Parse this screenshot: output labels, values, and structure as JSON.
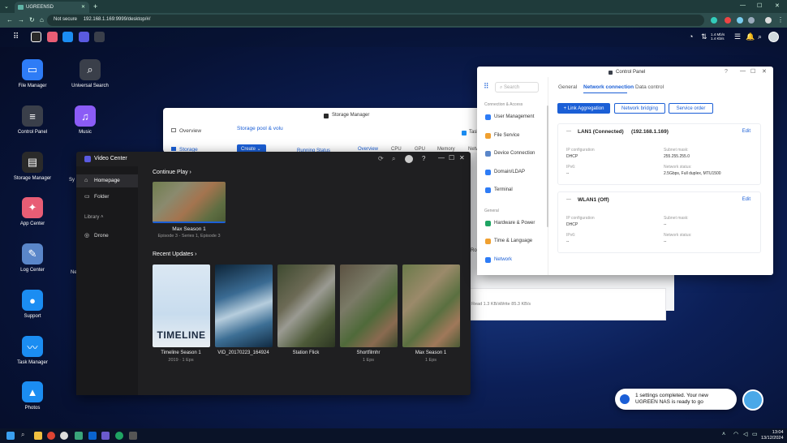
{
  "browser": {
    "tab_title": "UGREENSD",
    "not_secure": "Not secure",
    "url": "192.168.1.169:9999/desktop/#/"
  },
  "nas_bar": {
    "net_up": "1.4 Mb/s",
    "net_down": "1.4 Kb/s"
  },
  "desktop_icons": [
    {
      "label": "File Manager",
      "icon": "folder-icon",
      "color": "#2e7cf6"
    },
    {
      "label": "Universal Search",
      "icon": "search-icon",
      "color": "#3a3f4a"
    },
    {
      "label": "Control Panel",
      "icon": "control-panel-icon",
      "color": "#3a3f4a"
    },
    {
      "label": "Music",
      "icon": "music-icon",
      "color": "#8b5cf6"
    },
    {
      "label": "Storage Manager",
      "icon": "storage-icon",
      "color": "#2a2a2a"
    },
    {
      "label": "App Center",
      "icon": "app-center-icon",
      "color": "#e85d75"
    },
    {
      "label": "Log Center",
      "icon": "log-icon",
      "color": "#5a86c9"
    },
    {
      "label": "Support",
      "icon": "support-icon",
      "color": "#1b8df2"
    },
    {
      "label": "Task Manager",
      "icon": "task-manager-icon",
      "color": "#1b8df2"
    },
    {
      "label": "Photos",
      "icon": "photos-icon",
      "color": "#1b8df2"
    }
  ],
  "partial_desktop_labels": [
    "Sy",
    "Ne"
  ],
  "storage_manager": {
    "title": "Storage Manager",
    "side": [
      "Overview",
      "Storage"
    ],
    "tab": "Storage pool & volu",
    "create": "Create",
    "running": "Running Status",
    "subtabs": [
      "Overview",
      "CPU",
      "GPU",
      "Memory",
      "Netw"
    ],
    "task_label": "Task",
    "read": "Read 1.3 KB/s",
    "write": "Write 85.3 KB/s",
    "partial": "Ro"
  },
  "video_center": {
    "title": "Video Center",
    "nav": [
      "Homepage",
      "Folder"
    ],
    "library_label": "Library",
    "library_items": [
      "Drone"
    ],
    "continue_play": "Continue Play",
    "continue_item": {
      "title": "Max Season 1",
      "sub": "Episode 3 - Series 1, Episode 3"
    },
    "recent_updates": "Recent Updates",
    "recent": [
      {
        "title": "Timeline Season 1",
        "sub": "2019 · 1 Eps",
        "art": "timeline"
      },
      {
        "title": "VID_20170223_164924",
        "sub": "",
        "art": "sky"
      },
      {
        "title": "Station Flick",
        "sub": "",
        "art": "station"
      },
      {
        "title": "Shortfilmhr",
        "sub": "1 Eps",
        "art": "houses"
      },
      {
        "title": "Max Season 1",
        "sub": "1 Eps",
        "art": "aerial"
      }
    ],
    "timeline_poster_text": "TIMELINE"
  },
  "control_panel": {
    "title": "Control Panel",
    "search_placeholder": "Search",
    "categories": [
      {
        "label": "Connection & Access",
        "items": [
          "User Management",
          "File Service",
          "Device Connection",
          "Domain/LDAP",
          "Terminal"
        ]
      },
      {
        "label": "General",
        "items": [
          "Hardware & Power",
          "Time & Language",
          "Network"
        ]
      }
    ],
    "tabs": [
      "General",
      "Network connection",
      "Data control"
    ],
    "buttons": [
      "Link Aggregation",
      "Network bridging",
      "Service order"
    ],
    "lan": {
      "name": "LAN1 (Connected)",
      "ip": "(192.168.1.169)",
      "edit": "Edit",
      "ip_config_label": "IP configuration",
      "ip_config": "DHCP",
      "subnet_label": "Subnet mask:",
      "subnet": "255.255.255.0",
      "ipv6_label": "IPv6:",
      "ipv6": "--",
      "status_label": "Network status:",
      "status": "2.5Gbps, Full duplex, MTU1500"
    },
    "wlan": {
      "name": "WLAN1 (Off)",
      "edit": "Edit",
      "ip_config_label": "IP configuration",
      "ip_config": "DHCP",
      "subnet_label": "Subnet mask:",
      "subnet": "--",
      "ipv6_label": "IPv6:",
      "ipv6": "--",
      "status_label": "Network status:",
      "status": "--"
    }
  },
  "notification": {
    "text": "1 settings completed. Your new UGREEN NAS is ready to go"
  },
  "taskbar": {
    "time": "13:04",
    "date": "13/12/2024"
  },
  "colors": {
    "accent": "#1b5fd6",
    "chrome": "#1f3b3b",
    "video_bg": "#1f1f21"
  }
}
